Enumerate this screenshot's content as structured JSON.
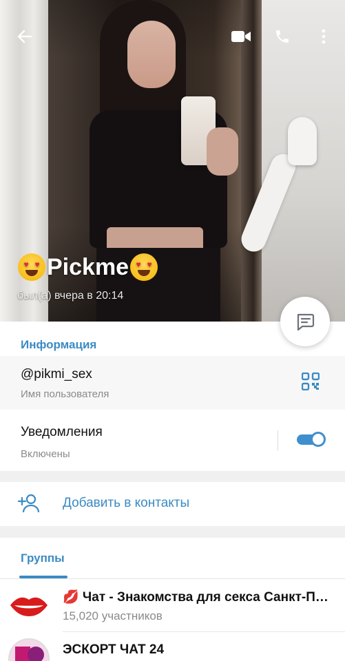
{
  "profile": {
    "name": "Pickme",
    "last_seen": "был(а) вчера в 20:14"
  },
  "header_icons": {
    "back": "arrow-left-icon",
    "video": "video-camera-icon",
    "call": "phone-icon",
    "more": "more-vertical-icon",
    "message": "message-icon"
  },
  "info": {
    "title": "Информация",
    "username": "@pikmi_sex",
    "username_label": "Имя пользователя",
    "notifications_label": "Уведомления",
    "notifications_status": "Включены",
    "notifications_on": true
  },
  "add_contact": {
    "label": "Добавить в контакты"
  },
  "groups": {
    "tab_label": "Группы",
    "items": [
      {
        "name": "💋 Чат - Знакомства для секса Санкт-Петербург",
        "members": "15,020 участников"
      },
      {
        "name": "ЭСКОРТ ЧАТ 24",
        "members": ""
      }
    ]
  },
  "colors": {
    "accent": "#3a8bc4",
    "toggle": "#3f8fcd"
  }
}
